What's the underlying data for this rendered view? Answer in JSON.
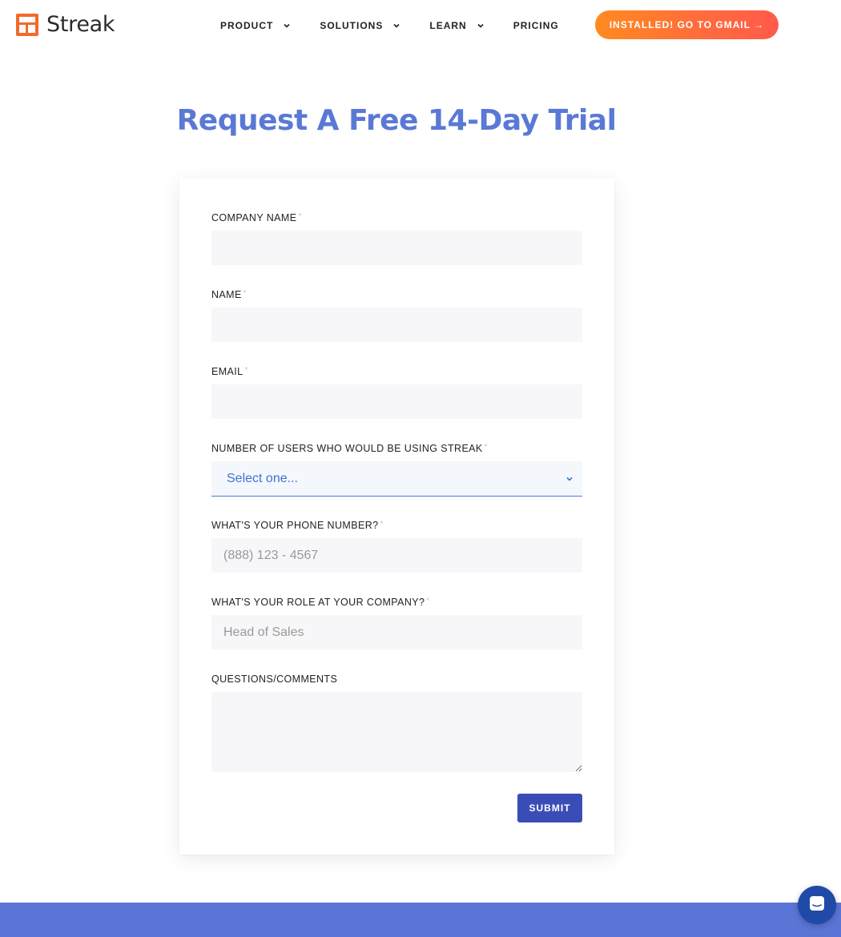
{
  "brand": {
    "name": "Streak",
    "accent": "#5a79d6",
    "logo_color": "#f26b2a"
  },
  "nav": {
    "items": [
      {
        "label": "PRODUCT",
        "has_dropdown": true
      },
      {
        "label": "SOLUTIONS",
        "has_dropdown": true
      },
      {
        "label": "LEARN",
        "has_dropdown": true
      },
      {
        "label": "PRICING",
        "has_dropdown": false
      }
    ],
    "cta_label": "INSTALLED! GO TO GMAIL →"
  },
  "page": {
    "title": "Request A Free 14-Day Trial"
  },
  "form": {
    "company_name": {
      "label": "COMPANY NAME",
      "required_mark": "*",
      "value": ""
    },
    "name": {
      "label": "NAME",
      "required_mark": "*",
      "value": ""
    },
    "email": {
      "label": "EMAIL",
      "required_mark": "*",
      "value": ""
    },
    "users": {
      "label": "NUMBER OF USERS WHO WOULD BE USING STREAK",
      "required_mark": "*",
      "selected": "Select one..."
    },
    "phone": {
      "label": "WHAT'S YOUR PHONE NUMBER?",
      "required_mark": "*",
      "placeholder": "(888) 123 - 4567",
      "value": ""
    },
    "role": {
      "label": "WHAT'S YOUR ROLE AT YOUR COMPANY?",
      "required_mark": "*",
      "placeholder": "Head of Sales",
      "value": ""
    },
    "comments": {
      "label": "QUESTIONS/COMMENTS",
      "value": ""
    },
    "submit_label": "SUBMIT"
  },
  "icons": {
    "chat": "chat-icon",
    "dropdown": "chevron-down-icon"
  },
  "colors": {
    "cta_start": "#ff8a1f",
    "cta_end": "#ff5a4a",
    "submit": "#3a4db7",
    "footer": "#5b75d6"
  }
}
